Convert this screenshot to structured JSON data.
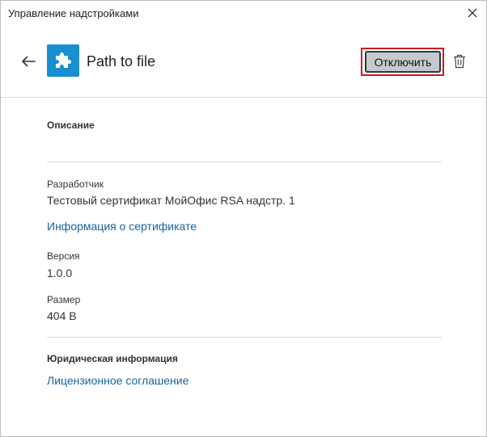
{
  "window": {
    "title": "Управление надстройками"
  },
  "header": {
    "plugin_name": "Path to file",
    "disable_label": "Отключить"
  },
  "description": {
    "label": "Описание"
  },
  "developer": {
    "label": "Разработчик",
    "value": "Тестовый сертификат МойОфис RSA надстр. 1",
    "cert_link": "Информация о сертификате"
  },
  "version": {
    "label": "Версия",
    "value": "1.0.0"
  },
  "size": {
    "label": "Размер",
    "value": "404 B"
  },
  "legal": {
    "label": "Юридическая информация",
    "license_link": "Лицензионное соглашение"
  },
  "icons": {
    "close": "close-icon",
    "back": "arrow-left-icon",
    "plugin": "puzzle-piece-icon",
    "delete": "trash-icon"
  },
  "colors": {
    "accent": "#1a8fd0",
    "link": "#1565a0",
    "focus_ring": "#d0191f"
  }
}
